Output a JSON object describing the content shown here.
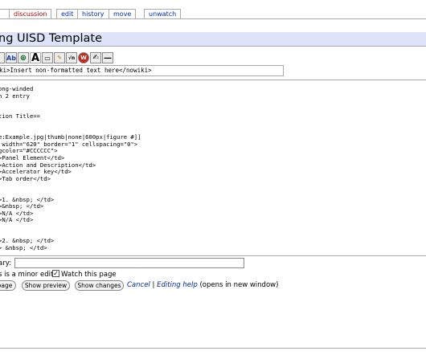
{
  "tabs": [
    {
      "label": "discussion",
      "red": true
    },
    {
      "label": "edit"
    },
    {
      "label": "history"
    },
    {
      "label": "move"
    },
    {
      "label": "unwatch"
    }
  ],
  "page_title": "ng UISD Template",
  "toolbar": {
    "icons": [
      "bold-icon",
      "italic-icon",
      "link-icon",
      "external-link-icon",
      "headline-icon",
      "image-icon",
      "media-icon",
      "math-icon",
      "nowiki-icon",
      "signature-icon",
      "hr-icon"
    ],
    "labels": [
      "B",
      "I",
      "Ab",
      "⊕",
      "A",
      "▭",
      "✎",
      "√n",
      "W",
      "✍",
      "—"
    ]
  },
  "tip_text": "ki>Insert non-formatted text here</nowiki>",
  "edit_lines": [
    "ong-winded",
    "n 2 entry",
    "",
    "",
    "tion Title==",
    "",
    "",
    "e:Example.jpg|thumb|none|600px|figure #]]",
    " width=\"620\" border=\"1\" cellspacing=\"0\">",
    "gcolor=\"#CCCCCC\">",
    ">Panel Element</td>",
    ">Action and Description</td>",
    ">Accelerator key</td>",
    ">Tab order</td>",
    "",
    "",
    ">1. &nbsp; </td>",
    ">&nbsp; </td>",
    ">N/A </td>",
    ">N/A </td>",
    "",
    "",
    ">2. &nbsp; </td>",
    "> &nbsp; </td>"
  ],
  "summary_label": "ary:",
  "summary_value": "",
  "minor_label": "s is a minor edit",
  "watch_label": "Watch this page",
  "buttons": {
    "save": "page",
    "preview": "Show preview",
    "changes": "Show changes"
  },
  "cancel_label": "Cancel",
  "help_link": "Editing help",
  "help_suffix": "(opens in new window)"
}
